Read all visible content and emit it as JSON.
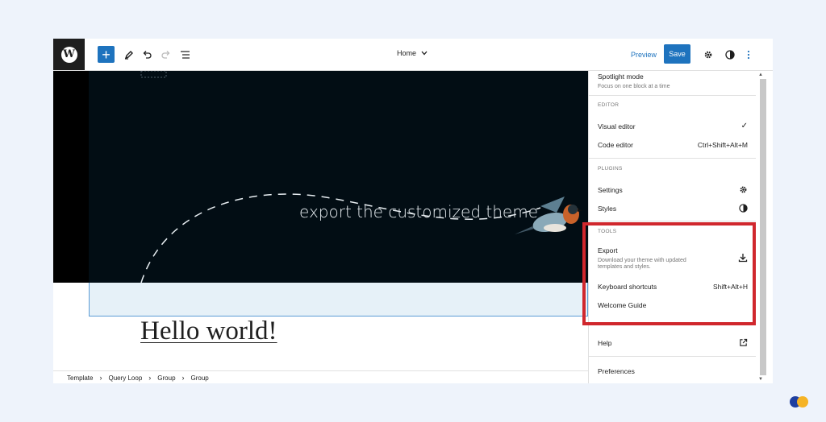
{
  "header": {
    "doc_title": "Home",
    "preview_label": "Preview",
    "save_label": "Save"
  },
  "canvas": {
    "hero_text": "export the customized theme",
    "heading": "Hello world!"
  },
  "breadcrumb": [
    "Template",
    "Query Loop",
    "Group",
    "Group"
  ],
  "menu": {
    "spotlight": {
      "label": "Spotlight mode",
      "desc": "Focus on one block at a time"
    },
    "editor_group": "EDITOR",
    "visual_editor": "Visual editor",
    "code_editor": "Code editor",
    "code_editor_shortcut": "Ctrl+Shift+Alt+M",
    "plugins_group": "PLUGINS",
    "settings": "Settings",
    "styles": "Styles",
    "tools_group": "TOOLS",
    "export": {
      "label": "Export",
      "desc1": "Download your theme with updated",
      "desc2": "templates and styles."
    },
    "keyboard_shortcuts": "Keyboard shortcuts",
    "keyboard_shortcuts_key": "Shift+Alt+H",
    "welcome_guide": "Welcome Guide",
    "help": "Help",
    "preferences": "Preferences"
  },
  "colors": {
    "accent": "#1e73be",
    "highlight": "#d0272d",
    "hero_bg": "#020d14"
  }
}
